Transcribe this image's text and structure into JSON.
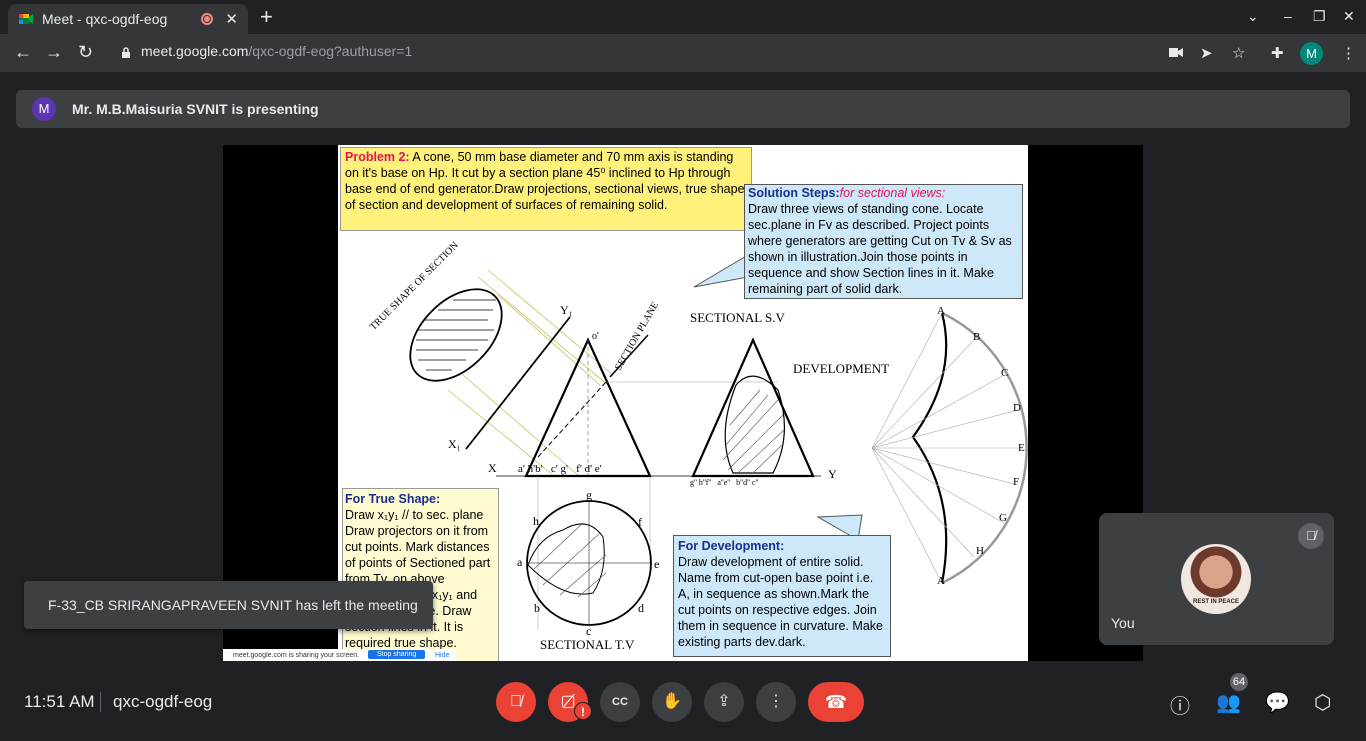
{
  "browser": {
    "tab_title": "Meet - qxc-ogdf-eog",
    "close_tab": "✕",
    "new_tab": "+",
    "url_domain": "meet.google.com",
    "url_path": "/qxc-ogdf-eog?authuser=1",
    "profile_initial": "M"
  },
  "presenting": {
    "avatar_initial": "M",
    "text": "Mr. M.B.Maisuria SVNIT is presenting"
  },
  "slide": {
    "problem_label": "Problem 2:",
    "problem_text": " A cone, 50 mm base diameter and 70 mm axis is standing on it's base on Hp. It cut by a section plane 45⁰ inclined  to Hp through base end of end generator.Draw projections, sectional views, true shape of section and development of surfaces of remaining solid.",
    "steps_label": "Solution Steps:",
    "steps_sub": "for sectional views:",
    "steps_text": "Draw three views of standing cone. Locate sec.plane in Fv as described. Project points where generators are  getting Cut on Tv & Sv as shown in  illustration.Join those points in sequence and show Section lines in it. Make remaining part of solid dark.",
    "true_label": "For True Shape:",
    "true_text": "Draw x₁y₁ // to sec. plane Draw projectors on it from cut points. Mark distances of points of Sectioned part from Tv, on above projectors from x₁y₁ and join in sequence. Draw section lines in it. It is required true shape.",
    "dev_label": "For Development:",
    "dev_text": "Draw development of entire solid. Name from cut-open base point i.e. A, in sequence as shown.Mark the cut points on respective edges. Join them in sequence in curvature. Make existing parts dev.dark.",
    "labels": {
      "true_shape": "TRUE SHAPE OF SECTION",
      "section_plane": "SECTION PLANE",
      "sectional_sv": "SECTIONAL S.V",
      "development": "DEVELOPMENT",
      "sectional_tv": "SECTIONAL T.V",
      "y1": "Y₁",
      "x1": "X₁",
      "x": "X",
      "y": "Y",
      "o": "o'",
      "fv_base": "a' h'b'   c' g'   f' d' e'",
      "sv_base": "g'' h''f''   a''e''   b''d'' c''",
      "tv_g": "g",
      "tv_h": "h",
      "tv_f": "f",
      "tv_a": "a",
      "tv_e": "e",
      "tv_b": "b",
      "tv_d": "d",
      "tv_c": "c",
      "dev_letters": [
        "A",
        "B",
        "C",
        "D",
        "E",
        "F",
        "G",
        "H",
        "A"
      ]
    }
  },
  "share_bar": {
    "text": "meet.google.com is sharing your screen.",
    "stop": "Stop sharing",
    "hide": "Hide"
  },
  "toast": "F-33_CB SRIRANGAPRAVEEN SVNIT has left the meeting",
  "self_tile": {
    "label": "You",
    "photo_caption": "REST IN PEACE"
  },
  "bottom": {
    "time": "11:51 AM",
    "meeting_code": "qxc-ogdf-eog",
    "participant_count": "64",
    "alert_badge": "!"
  },
  "colors": {
    "end_call": "#ea4335",
    "problem_highlight": "#fff17a",
    "steps_box": "#cde8f8"
  }
}
